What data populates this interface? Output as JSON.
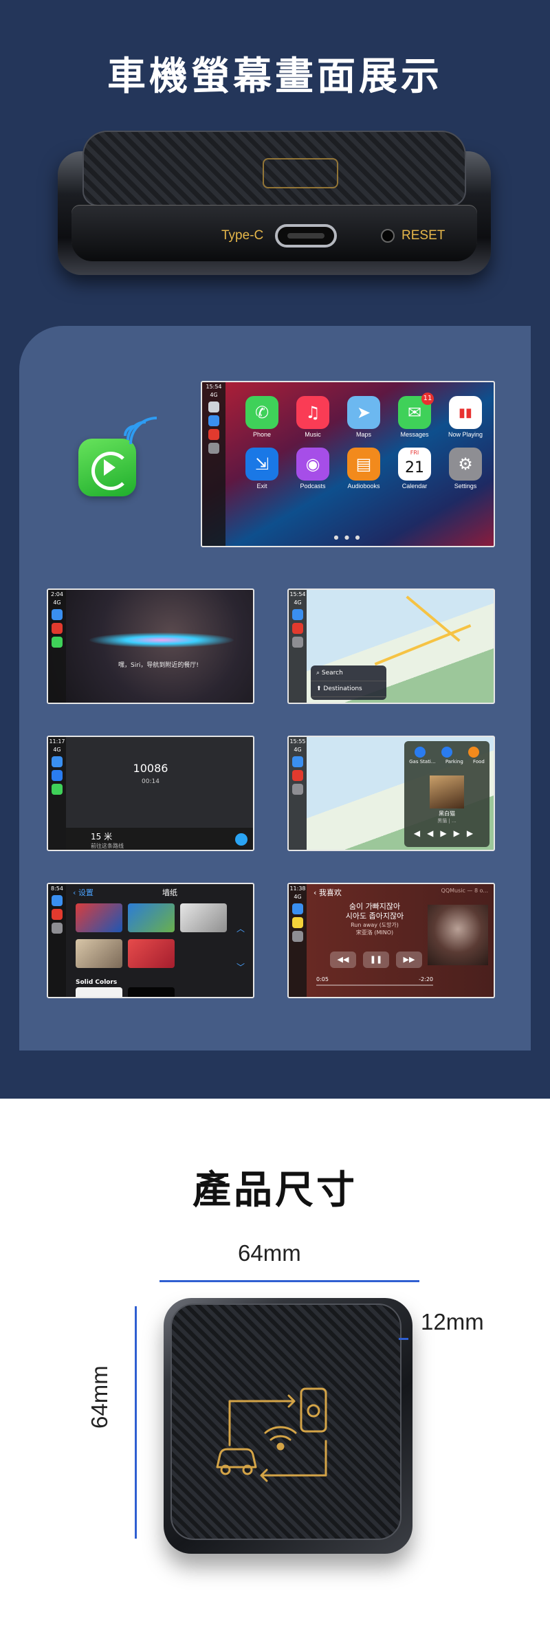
{
  "page": {
    "title": "車機螢幕畫面展示"
  },
  "device": {
    "port_label": "Type-C",
    "reset_label": "RESET"
  },
  "main_screen": {
    "time": "15:54",
    "signal": "4G",
    "apps": [
      {
        "name": "Phone",
        "color": "#3fd159",
        "icon": "phone-icon",
        "glyph": "✆"
      },
      {
        "name": "Music",
        "color": "#fa3c55",
        "icon": "music-icon",
        "glyph": "♫"
      },
      {
        "name": "Maps",
        "color": "#6cb8f0",
        "icon": "maps-icon",
        "glyph": "➤"
      },
      {
        "name": "Messages",
        "color": "#3fd159",
        "icon": "messages-icon",
        "glyph": "✉",
        "badge": "11"
      },
      {
        "name": "Now Playing",
        "color": "#ffffff",
        "icon": "now-playing-icon",
        "glyph": "▮▮"
      },
      {
        "name": "Exit",
        "color": "#1a78e6",
        "icon": "exit-icon",
        "glyph": "⇲"
      },
      {
        "name": "Podcasts",
        "color": "#a64ee8",
        "icon": "podcasts-icon",
        "glyph": "◉"
      },
      {
        "name": "Audiobooks",
        "color": "#f28a1c",
        "icon": "audiobooks-icon",
        "glyph": "▤"
      },
      {
        "name": "Calendar",
        "color": "#ffffff",
        "icon": "calendar-icon",
        "glyph": "21",
        "small": "FRI"
      },
      {
        "name": "Settings",
        "color": "#8e8e93",
        "icon": "settings-icon",
        "glyph": "⚙"
      }
    ]
  },
  "screens": {
    "siri": {
      "time": "2:04",
      "signal": "4G",
      "text": "嘿，Siri，导航到附近的餐厅!"
    },
    "maps": {
      "time": "15:54",
      "signal": "4G",
      "search": "Search",
      "destinations": "Destinations"
    },
    "call": {
      "time": "11:17",
      "signal": "4G",
      "number": "10086",
      "duration": "00:14",
      "nav_distance": "15 米",
      "nav_hint": "前往这条路线"
    },
    "poi": {
      "time": "15:55",
      "signal": "4G",
      "cats": [
        "Gas Stati...",
        "Parking",
        "Food"
      ],
      "song": "黑白猫",
      "artist": "黑猫 | ..."
    },
    "wallpaper": {
      "time": "8:54",
      "back": "设置",
      "title": "墙纸",
      "section": "Solid Colors"
    },
    "music": {
      "time": "11:38",
      "signal": "4G",
      "back": "我喜欢",
      "app": "QQMusic — 8 o...",
      "line1": "숨이 가빠지잖아",
      "line2": "시아도 좁아지잖아",
      "line3": "Run away (도망가)",
      "line4": "宋亚洛 (MINO)",
      "elapsed": "0:05",
      "remaining": "-2:20"
    }
  },
  "dimensions": {
    "title": "產品尺寸",
    "width": "64mm",
    "height": "64mm",
    "thickness": "12mm",
    "accent": "#2f5fd1"
  }
}
